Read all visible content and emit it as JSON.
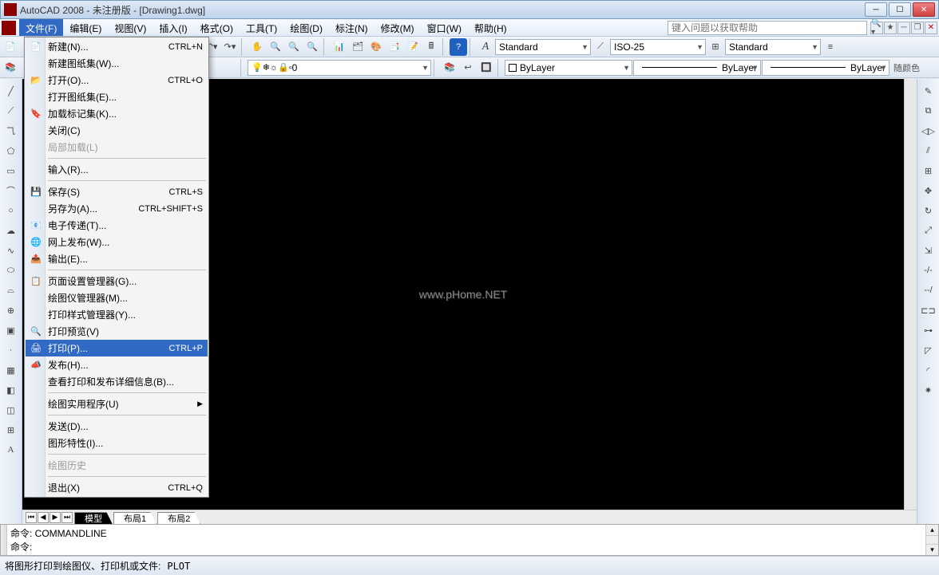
{
  "title": "AutoCAD 2008 - 未注册版 - [Drawing1.dwg]",
  "menubar": {
    "items": [
      "文件(F)",
      "编辑(E)",
      "视图(V)",
      "插入(I)",
      "格式(O)",
      "工具(T)",
      "绘图(D)",
      "标注(N)",
      "修改(M)",
      "窗口(W)",
      "帮助(H)"
    ],
    "help_placeholder": "键入问题以获取帮助"
  },
  "toolbar1": {
    "style1": "Standard",
    "style2": "ISO-25",
    "style3": "Standard"
  },
  "toolbar2": {
    "layer": "0",
    "color": "ByLayer",
    "ltype": "ByLayer",
    "lweight": "ByLayer",
    "bycolor": "随颜色"
  },
  "tabs": {
    "model": "模型",
    "layout1": "布局1",
    "layout2": "布局2"
  },
  "watermark": "www.pHome.NET",
  "cmd": {
    "line1": "命令: COMMANDLINE",
    "line2": "命令:"
  },
  "status": {
    "hint": "将图形打印到绘图仪、打印机或文件:",
    "cmd": "PLOT"
  },
  "file_menu": [
    {
      "icon": "📄",
      "label": "新建(N)...",
      "shortcut": "CTRL+N",
      "name": "new"
    },
    {
      "icon": "",
      "label": "新建图纸集(W)...",
      "shortcut": "",
      "name": "new-sheetset"
    },
    {
      "icon": "📂",
      "label": "打开(O)...",
      "shortcut": "CTRL+O",
      "name": "open"
    },
    {
      "icon": "",
      "label": "打开图纸集(E)...",
      "shortcut": "",
      "name": "open-sheetset"
    },
    {
      "icon": "🔖",
      "label": "加载标记集(K)...",
      "shortcut": "",
      "name": "load-markup"
    },
    {
      "icon": "",
      "label": "关闭(C)",
      "shortcut": "",
      "name": "close"
    },
    {
      "icon": "",
      "label": "局部加载(L)",
      "shortcut": "",
      "name": "partial-load",
      "disabled": true
    },
    {
      "sep": true
    },
    {
      "icon": "",
      "label": "输入(R)...",
      "shortcut": "",
      "name": "import"
    },
    {
      "sep": true
    },
    {
      "icon": "💾",
      "label": "保存(S)",
      "shortcut": "CTRL+S",
      "name": "save"
    },
    {
      "icon": "",
      "label": "另存为(A)...",
      "shortcut": "CTRL+SHIFT+S",
      "name": "saveas"
    },
    {
      "icon": "📧",
      "label": "电子传递(T)...",
      "shortcut": "",
      "name": "etransmit"
    },
    {
      "icon": "🌐",
      "label": "网上发布(W)...",
      "shortcut": "",
      "name": "web-publish"
    },
    {
      "icon": "📤",
      "label": "输出(E)...",
      "shortcut": "",
      "name": "export"
    },
    {
      "sep": true
    },
    {
      "icon": "📋",
      "label": "页面设置管理器(G)...",
      "shortcut": "",
      "name": "page-setup"
    },
    {
      "icon": "",
      "label": "绘图仪管理器(M)...",
      "shortcut": "",
      "name": "plotter-manager"
    },
    {
      "icon": "",
      "label": "打印样式管理器(Y)...",
      "shortcut": "",
      "name": "plotstyle-manager"
    },
    {
      "icon": "🔍",
      "label": "打印预览(V)",
      "shortcut": "",
      "name": "print-preview"
    },
    {
      "icon": "🖨",
      "label": "打印(P)...",
      "shortcut": "CTRL+P",
      "name": "print",
      "highlight": true
    },
    {
      "icon": "📣",
      "label": "发布(H)...",
      "shortcut": "",
      "name": "publish"
    },
    {
      "icon": "",
      "label": "查看打印和发布详细信息(B)...",
      "shortcut": "",
      "name": "view-plot-details"
    },
    {
      "sep": true
    },
    {
      "icon": "",
      "label": "绘图实用程序(U)",
      "shortcut": "",
      "name": "draw-utils",
      "submenu": true
    },
    {
      "sep": true
    },
    {
      "icon": "",
      "label": "发送(D)...",
      "shortcut": "",
      "name": "send"
    },
    {
      "icon": "",
      "label": "图形特性(I)...",
      "shortcut": "",
      "name": "drawing-props"
    },
    {
      "sep": true
    },
    {
      "icon": "",
      "label": "绘图历史",
      "shortcut": "",
      "name": "draw-history",
      "disabled": true
    },
    {
      "sep": true
    },
    {
      "icon": "",
      "label": "退出(X)",
      "shortcut": "CTRL+Q",
      "name": "exit"
    }
  ]
}
